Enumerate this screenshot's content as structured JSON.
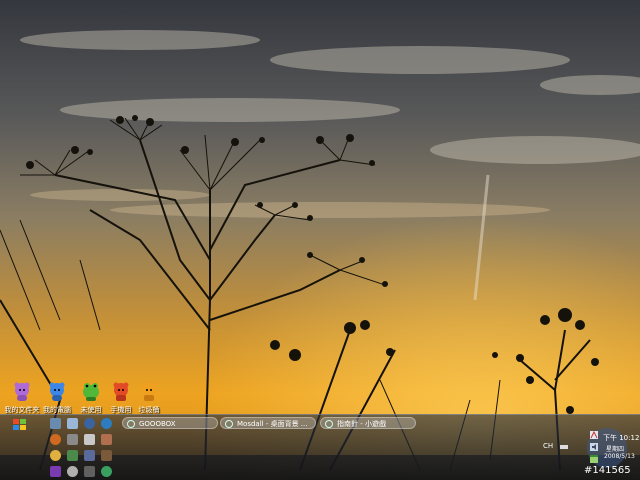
{
  "desktop": {
    "icons": [
      {
        "label": "我的文件夹",
        "icon": "purple-bear-icon",
        "color": "#b06ad8"
      },
      {
        "label": "我的電腦",
        "icon": "blue-bear-icon",
        "color": "#3b86e6"
      },
      {
        "label": "未使用",
        "icon": "green-frog-icon",
        "color": "#4fb838"
      },
      {
        "label": "手機用",
        "icon": "red-bear-icon",
        "color": "#e24b26"
      },
      {
        "label": "垃圾桶",
        "icon": "orange-bear-icon",
        "color": "#f0a020"
      }
    ]
  },
  "taskbar": {
    "tasks": [
      {
        "label": "GOOOBOX",
        "icon": "window-icon"
      },
      {
        "label": "Mosdall - 桌面背景 ...",
        "icon": "browser-icon"
      },
      {
        "label": "指南針 - 小遊戲",
        "icon": "game-icon"
      }
    ],
    "tray": {
      "language": "CH",
      "time": "下午 10:12",
      "weekday": "星期四",
      "date": "2008/5/13"
    }
  },
  "watermark": "#141565",
  "colors": {
    "sky_top": "#3a3d45",
    "sky_mid": "#9a8a70",
    "horizon": "#f2a41a",
    "taskbar": "#1c2330"
  }
}
